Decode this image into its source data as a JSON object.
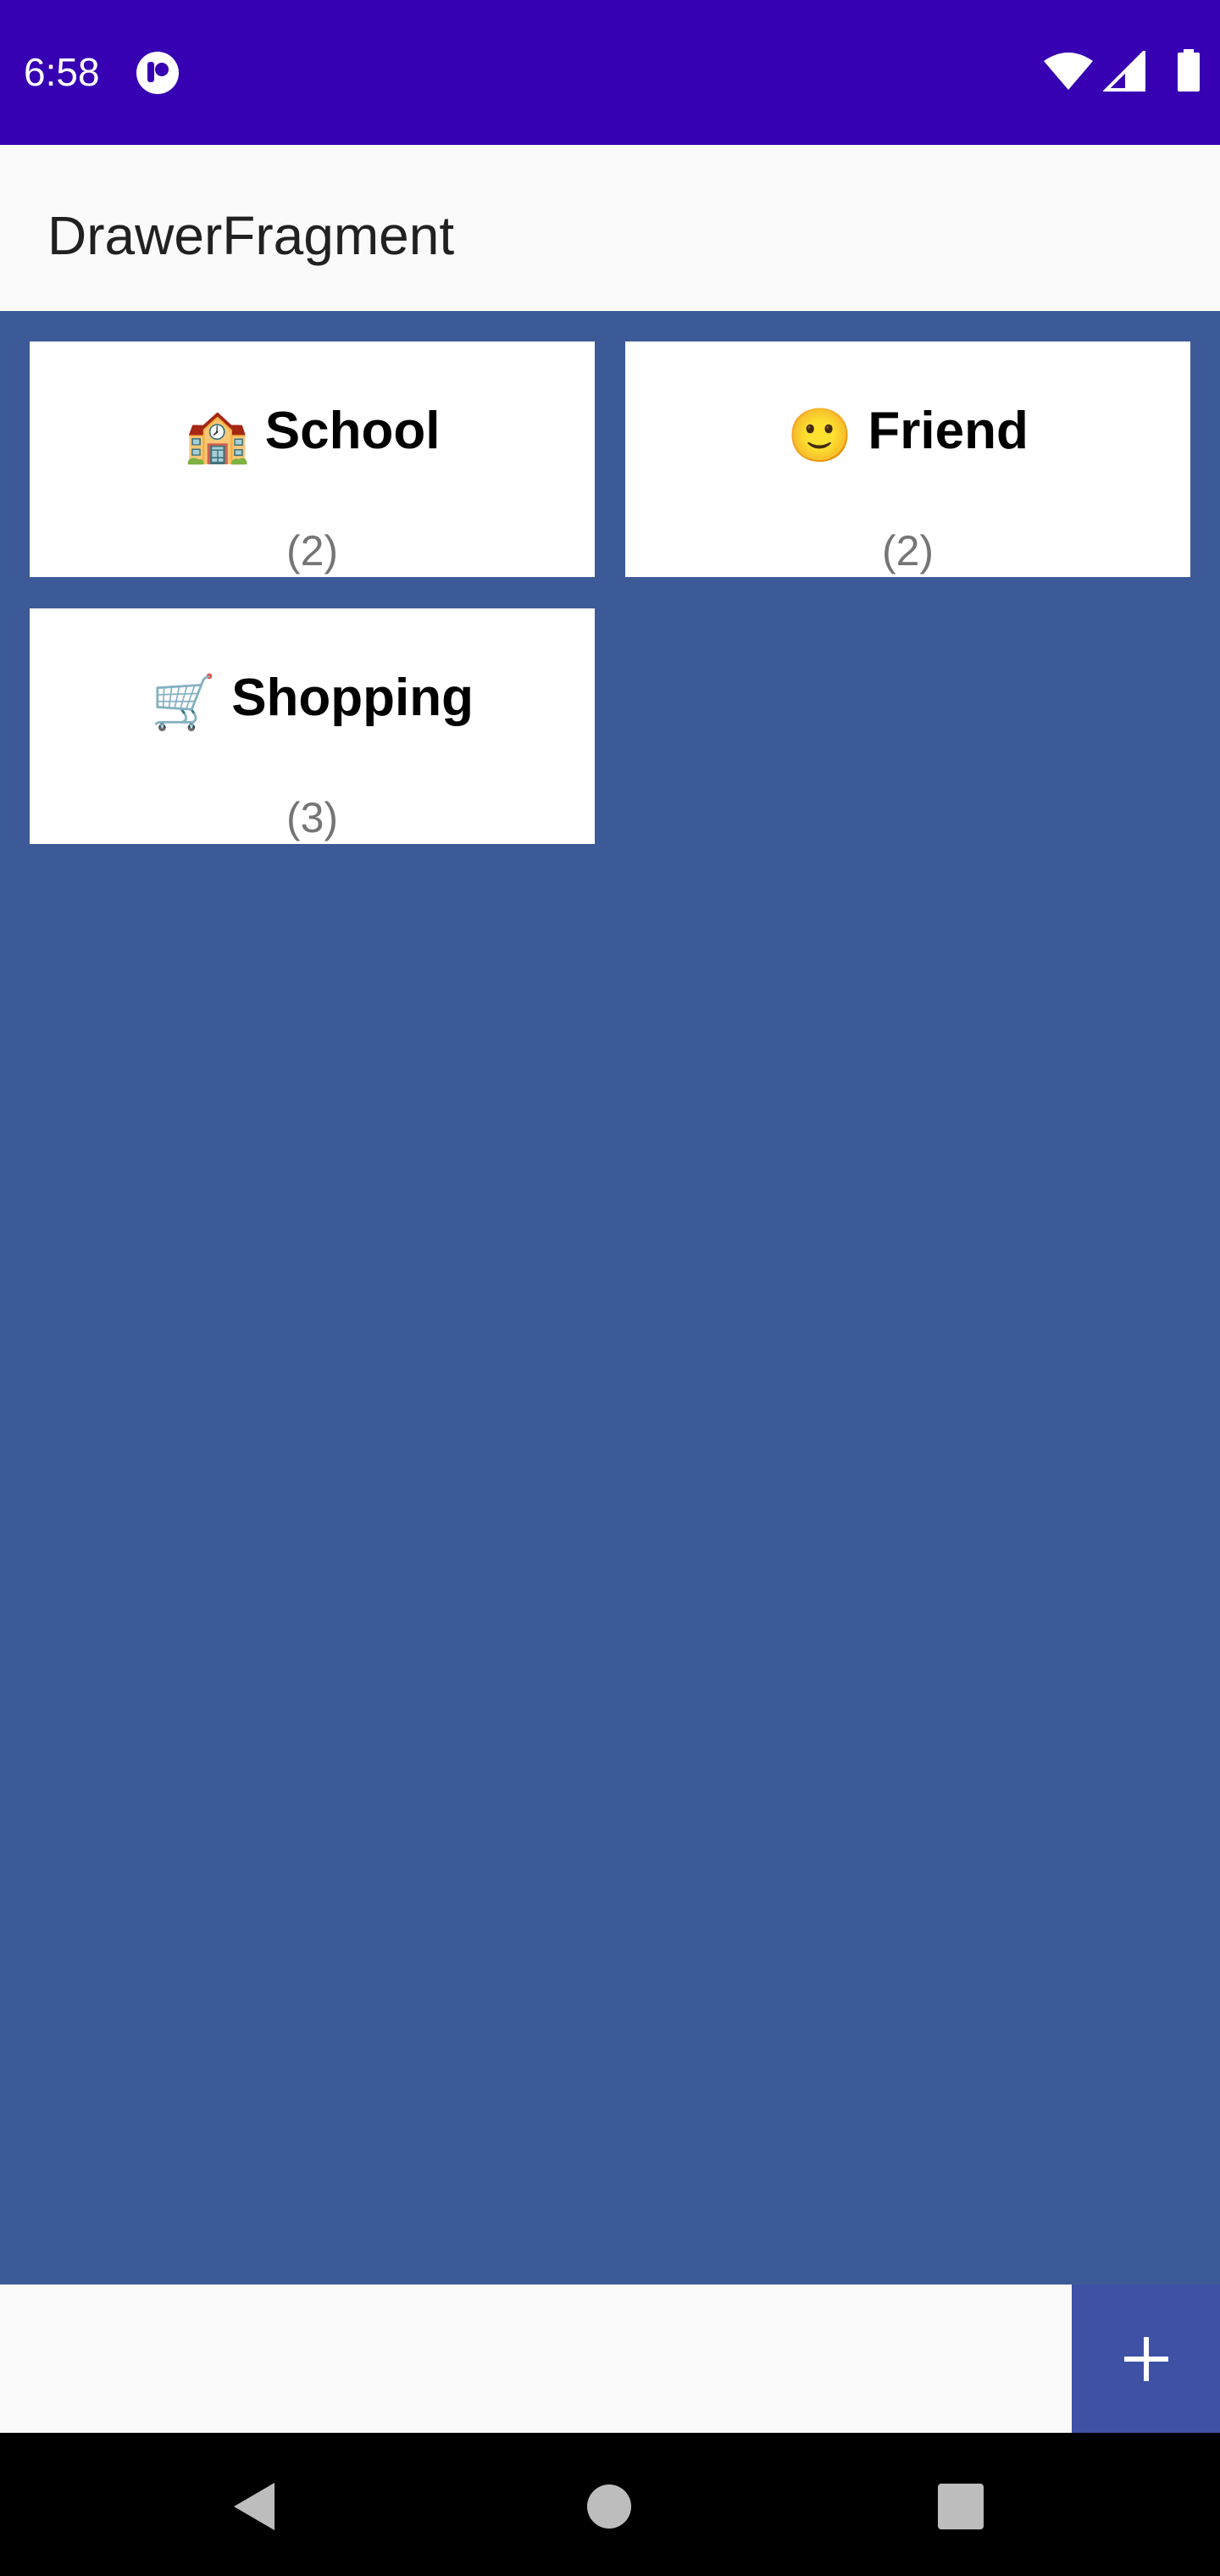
{
  "status_bar": {
    "time": "6:58",
    "background": "#3700b3"
  },
  "app_bar": {
    "title": "DrawerFragment"
  },
  "categories": [
    {
      "emoji": "🏫",
      "icon": "school-icon",
      "name": "School",
      "count": "(2)"
    },
    {
      "emoji": "🙂",
      "icon": "smiley-icon",
      "name": "Friend",
      "count": "(2)"
    },
    {
      "emoji": "🛒",
      "icon": "shopping-cart-icon",
      "name": "Shopping",
      "count": "(3)"
    }
  ],
  "fab": {
    "icon": "plus-icon",
    "color": "#3f51a5"
  },
  "colors": {
    "content_background": "#3d5a98",
    "card_background": "#ffffff",
    "count_text": "#757575"
  }
}
